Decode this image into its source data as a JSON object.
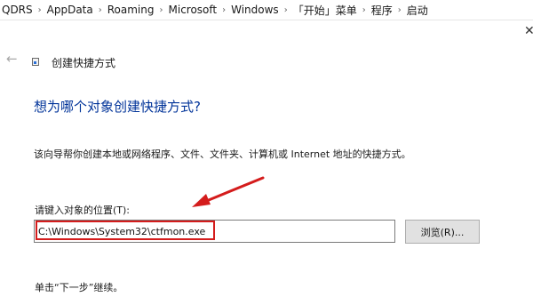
{
  "breadcrumb": {
    "items": [
      "QDRS",
      "AppData",
      "Roaming",
      "Microsoft",
      "Windows",
      "「开始」菜单",
      "程序",
      "启动"
    ],
    "separator": "›"
  },
  "window": {
    "close_glyph": "✕"
  },
  "wizard": {
    "back_glyph": "←",
    "title": "创建快捷方式",
    "heading": "想为哪个对象创建快捷方式?",
    "description": "该向导帮你创建本地或网络程序、文件、文件夹、计算机或 Internet 地址的快捷方式。",
    "location_label": "请键入对象的位置(T):",
    "location_value": "C:\\Windows\\System32\\ctfmon.exe",
    "browse_label": "浏览(R)...",
    "footer_hint": "单击“下一步”继续。"
  },
  "colors": {
    "heading": "#003399",
    "annotation_red": "#d41c1c",
    "button_face": "#e1e1e1"
  }
}
